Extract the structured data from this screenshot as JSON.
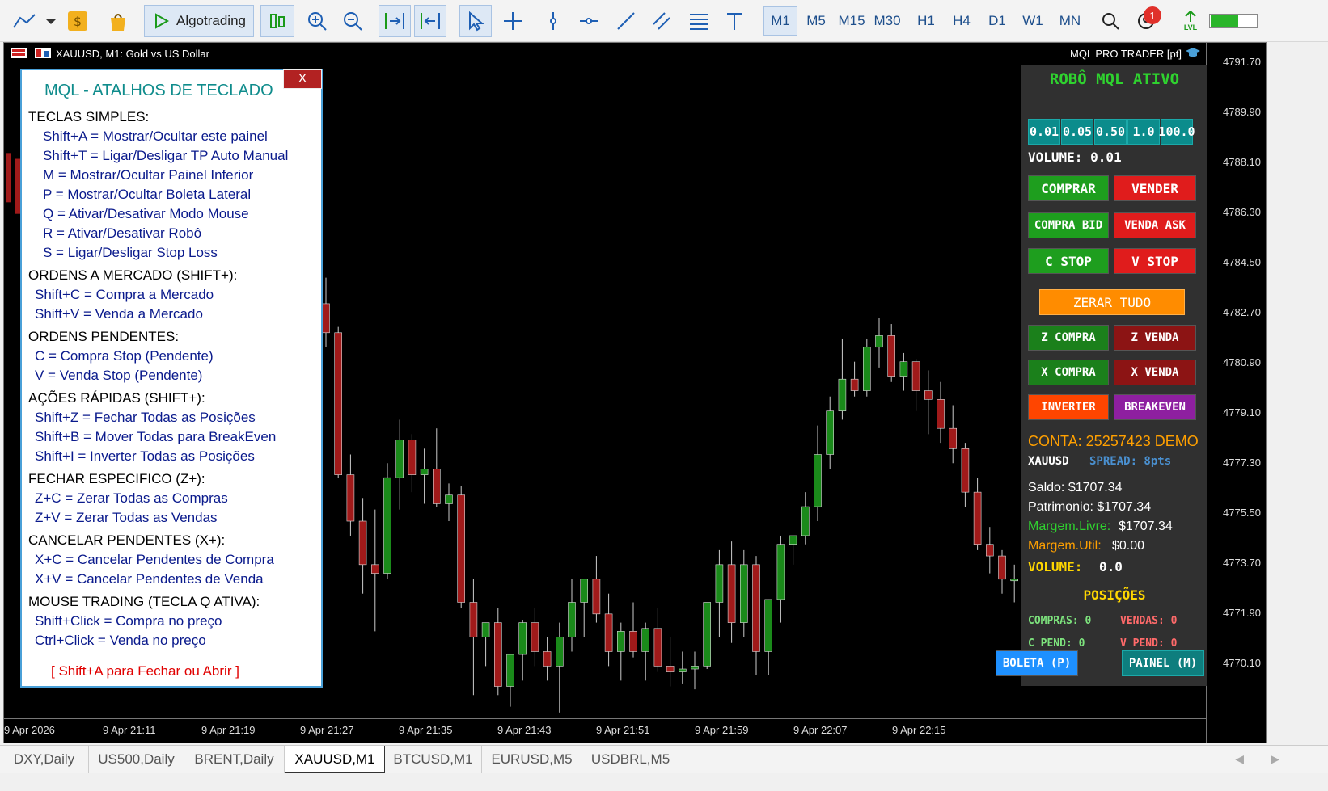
{
  "toolbar": {
    "algotrading_label": "Algotrading",
    "timeframes": [
      "M1",
      "M5",
      "M15",
      "M30",
      "H1",
      "H4",
      "D1",
      "W1",
      "MN"
    ],
    "active_timeframe": "M1",
    "notification_count": "1",
    "lvl_label": "LVL"
  },
  "chart": {
    "title": "XAUUSD, M1:  Gold vs US Dollar",
    "brand": "MQL PRO TRADER [pt]",
    "price_labels": [
      "4791.70",
      "4789.90",
      "4788.10",
      "4786.30",
      "4784.50",
      "4782.70",
      "4780.90",
      "4779.10",
      "4777.30",
      "4775.50",
      "4773.70",
      "4771.90",
      "4770.10"
    ],
    "time_labels": [
      "9 Apr 2026",
      "9 Apr 21:11",
      "9 Apr 21:19",
      "9 Apr 21:27",
      "9 Apr 21:35",
      "9 Apr 21:43",
      "9 Apr 21:51",
      "9 Apr 21:59",
      "9 Apr 22:07",
      "9 Apr 22:15"
    ],
    "colors": {
      "bull": "#1a8a1a",
      "bear": "#a01a1a"
    }
  },
  "chart_data": {
    "type": "candlestick",
    "symbol": "XAUUSD",
    "timeframe": "M1",
    "ylim": [
      4769.2,
      4792.5
    ],
    "candles": [
      {
        "o": 4783.5,
        "h": 4784.4,
        "l": 4782.0,
        "c": 4782.5
      },
      {
        "o": 4782.5,
        "h": 4782.7,
        "l": 4777.5,
        "c": 4777.6
      },
      {
        "o": 4777.6,
        "h": 4778.3,
        "l": 4775.5,
        "c": 4776.0
      },
      {
        "o": 4776.0,
        "h": 4776.8,
        "l": 4773.5,
        "c": 4774.5
      },
      {
        "o": 4774.5,
        "h": 4776.4,
        "l": 4772.2,
        "c": 4774.2
      },
      {
        "o": 4774.2,
        "h": 4778.0,
        "l": 4774.0,
        "c": 4777.5
      },
      {
        "o": 4777.5,
        "h": 4779.5,
        "l": 4776.4,
        "c": 4778.8
      },
      {
        "o": 4778.8,
        "h": 4779.0,
        "l": 4777.0,
        "c": 4777.6
      },
      {
        "o": 4777.6,
        "h": 4778.5,
        "l": 4776.6,
        "c": 4777.8
      },
      {
        "o": 4777.8,
        "h": 4779.2,
        "l": 4776.5,
        "c": 4776.6
      },
      {
        "o": 4776.6,
        "h": 4777.3,
        "l": 4776.0,
        "c": 4776.9
      },
      {
        "o": 4776.9,
        "h": 4777.2,
        "l": 4773.0,
        "c": 4773.2
      },
      {
        "o": 4773.2,
        "h": 4774.0,
        "l": 4770.0,
        "c": 4772.0
      },
      {
        "o": 4772.0,
        "h": 4772.5,
        "l": 4771.0,
        "c": 4772.5
      },
      {
        "o": 4772.5,
        "h": 4773.0,
        "l": 4770.0,
        "c": 4770.3
      },
      {
        "o": 4770.3,
        "h": 4771.2,
        "l": 4769.6,
        "c": 4771.4
      },
      {
        "o": 4771.4,
        "h": 4772.6,
        "l": 4770.5,
        "c": 4772.5
      },
      {
        "o": 4772.5,
        "h": 4773.0,
        "l": 4771.0,
        "c": 4771.5
      },
      {
        "o": 4771.5,
        "h": 4772.0,
        "l": 4770.5,
        "c": 4771.0
      },
      {
        "o": 4771.0,
        "h": 4772.5,
        "l": 4769.4,
        "c": 4772.0
      },
      {
        "o": 4772.0,
        "h": 4774.0,
        "l": 4771.5,
        "c": 4773.2
      },
      {
        "o": 4773.2,
        "h": 4773.8,
        "l": 4772.0,
        "c": 4774.0
      },
      {
        "o": 4774.0,
        "h": 4774.8,
        "l": 4772.5,
        "c": 4772.8
      },
      {
        "o": 4772.8,
        "h": 4773.5,
        "l": 4771.0,
        "c": 4771.5
      },
      {
        "o": 4771.5,
        "h": 4772.5,
        "l": 4770.5,
        "c": 4772.2
      },
      {
        "o": 4772.2,
        "h": 4773.2,
        "l": 4771.3,
        "c": 4771.5
      },
      {
        "o": 4771.5,
        "h": 4772.5,
        "l": 4770.5,
        "c": 4772.3
      },
      {
        "o": 4772.3,
        "h": 4773.0,
        "l": 4770.8,
        "c": 4771.0
      },
      {
        "o": 4771.0,
        "h": 4772.0,
        "l": 4770.3,
        "c": 4770.8
      },
      {
        "o": 4770.8,
        "h": 4771.5,
        "l": 4770.4,
        "c": 4770.9
      },
      {
        "o": 4770.9,
        "h": 4771.5,
        "l": 4770.2,
        "c": 4771.0
      },
      {
        "o": 4771.0,
        "h": 4773.0,
        "l": 4770.9,
        "c": 4773.2
      },
      {
        "o": 4773.2,
        "h": 4775.0,
        "l": 4772.0,
        "c": 4774.5
      },
      {
        "o": 4774.5,
        "h": 4775.3,
        "l": 4771.8,
        "c": 4772.5
      },
      {
        "o": 4772.5,
        "h": 4775.0,
        "l": 4772.0,
        "c": 4774.5
      },
      {
        "o": 4774.5,
        "h": 4774.8,
        "l": 4770.7,
        "c": 4771.5
      },
      {
        "o": 4771.5,
        "h": 4773.3,
        "l": 4770.7,
        "c": 4773.3
      },
      {
        "o": 4773.3,
        "h": 4775.5,
        "l": 4772.5,
        "c": 4775.2
      },
      {
        "o": 4775.2,
        "h": 4775.5,
        "l": 4774.5,
        "c": 4775.5
      },
      {
        "o": 4775.5,
        "h": 4777.0,
        "l": 4775.2,
        "c": 4776.5
      },
      {
        "o": 4776.5,
        "h": 4779.3,
        "l": 4776.0,
        "c": 4778.3
      },
      {
        "o": 4778.3,
        "h": 4780.3,
        "l": 4777.8,
        "c": 4779.8
      },
      {
        "o": 4779.8,
        "h": 4782.3,
        "l": 4779.5,
        "c": 4780.9
      },
      {
        "o": 4780.9,
        "h": 4781.5,
        "l": 4780.3,
        "c": 4780.5
      },
      {
        "o": 4780.5,
        "h": 4782.3,
        "l": 4780.3,
        "c": 4782.0
      },
      {
        "o": 4782.0,
        "h": 4783.0,
        "l": 4781.3,
        "c": 4782.4
      },
      {
        "o": 4782.4,
        "h": 4782.8,
        "l": 4780.8,
        "c": 4781.0
      },
      {
        "o": 4781.0,
        "h": 4781.8,
        "l": 4780.5,
        "c": 4781.5
      },
      {
        "o": 4781.5,
        "h": 4781.6,
        "l": 4779.8,
        "c": 4780.5
      },
      {
        "o": 4780.5,
        "h": 4781.2,
        "l": 4779.0,
        "c": 4780.2
      },
      {
        "o": 4780.2,
        "h": 4780.8,
        "l": 4778.7,
        "c": 4779.2
      },
      {
        "o": 4779.2,
        "h": 4780.0,
        "l": 4778.0,
        "c": 4778.5
      },
      {
        "o": 4778.5,
        "h": 4778.7,
        "l": 4776.5,
        "c": 4777.0
      },
      {
        "o": 4777.0,
        "h": 4777.5,
        "l": 4775.0,
        "c": 4775.2
      },
      {
        "o": 4775.2,
        "h": 4775.8,
        "l": 4774.2,
        "c": 4774.8
      },
      {
        "o": 4774.8,
        "h": 4775.0,
        "l": 4773.5,
        "c": 4774.0
      },
      {
        "o": 4774.0,
        "h": 4774.5,
        "l": 4773.2,
        "c": 4774.0
      },
      {
        "o": 4774.0,
        "h": 4774.6,
        "l": 4772.9,
        "c": 4773.8
      }
    ]
  },
  "shortcuts_panel": {
    "close_label": "X",
    "title": "MQL - ATALHOS DE TECLADO",
    "lines": [
      {
        "t": "h",
        "text": "TECLAS SIMPLES:"
      },
      {
        "t": "k2",
        "text": "Shift+A = Mostrar/Ocultar este painel"
      },
      {
        "t": "k2",
        "text": "Shift+T = Ligar/Desligar TP Auto Manual"
      },
      {
        "t": "k2",
        "text": "M = Mostrar/Ocultar Painel Inferior"
      },
      {
        "t": "k2",
        "text": "P = Mostrar/Ocultar Boleta Lateral"
      },
      {
        "t": "k2",
        "text": "Q = Ativar/Desativar Modo Mouse"
      },
      {
        "t": "k2",
        "text": "R = Ativar/Desativar Robô"
      },
      {
        "t": "k2",
        "text": "S = Ligar/Desligar Stop Loss"
      },
      {
        "t": "h",
        "text": "ORDENS A MERCADO (SHIFT+):"
      },
      {
        "t": "k1",
        "text": "Shift+C = Compra a Mercado"
      },
      {
        "t": "k1",
        "text": "Shift+V = Venda a Mercado"
      },
      {
        "t": "h",
        "text": "ORDENS PENDENTES:"
      },
      {
        "t": "k1",
        "text": "C = Compra Stop (Pendente)"
      },
      {
        "t": "k1",
        "text": "V = Venda Stop (Pendente)"
      },
      {
        "t": "h",
        "text": "AÇÕES RÁPIDAS (SHIFT+):"
      },
      {
        "t": "k1",
        "text": "Shift+Z = Fechar Todas as Posições"
      },
      {
        "t": "k1",
        "text": "Shift+B = Mover Todas para BreakEven"
      },
      {
        "t": "k1",
        "text": "Shift+I = Inverter Todas as Posições"
      },
      {
        "t": "h",
        "text": "FECHAR ESPECIFICO (Z+):"
      },
      {
        "t": "k1",
        "text": "Z+C = Zerar Todas as Compras"
      },
      {
        "t": "k1",
        "text": "Z+V = Zerar Todas as Vendas"
      },
      {
        "t": "h",
        "text": "CANCELAR PENDENTES (X+):"
      },
      {
        "t": "k1",
        "text": "X+C = Cancelar Pendentes de Compra"
      },
      {
        "t": "k1",
        "text": "X+V = Cancelar Pendentes de Venda"
      },
      {
        "t": "h",
        "text": "MOUSE TRADING (TECLA Q ATIVA):"
      },
      {
        "t": "k1",
        "text": "Shift+Click = Compra no preço"
      },
      {
        "t": "k1",
        "text": "Ctrl+Click  = Venda no preço"
      },
      {
        "t": "f",
        "text": "[ Shift+A para Fechar ou Abrir ]"
      }
    ]
  },
  "robot_panel": {
    "status": "ROBÔ MQL ATIVO",
    "lots": [
      "0.01",
      "0.05",
      "0.50",
      "1.0",
      "100.0"
    ],
    "volume": "VOLUME: 0.01",
    "buttons": {
      "comprar": "COMPRAR",
      "vender": "VENDER",
      "compra_bid": "COMPRA BID",
      "venda_ask": "VENDA ASK",
      "c_stop": "C STOP",
      "v_stop": "V STOP",
      "zerar_tudo": "ZERAR TUDO",
      "z_compra": "Z COMPRA",
      "z_venda": "Z VENDA",
      "x_compra": "X COMPRA",
      "x_venda": "X VENDA",
      "inverter": "INVERTER",
      "breakeven": "BREAKEVEN",
      "boleta": "BOLETA (P)",
      "painel": "PAINEL (M)"
    },
    "account": "CONTA: 25257423 DEMO",
    "symbol": "XAUUSD",
    "spread": "SPREAD: 8pts",
    "saldo": "Saldo: $1707.34",
    "patrimonio": "Patrimonio: $1707.34",
    "margem_livre_label": "Margem.Livre:",
    "margem_livre_value": "$1707.34",
    "margem_util_label": "Margem.Util:",
    "margem_util_value": "$0.00",
    "volume_label": "VOLUME:",
    "volume_value": "0.0",
    "posicoes": "POSIÇÕES",
    "compras": "COMPRAS: 0",
    "vendas": "VENDAS: 0",
    "c_pend": "C PEND: 0",
    "v_pend": "V PEND: 0"
  },
  "tabs": {
    "items": [
      "DXY,Daily",
      "US500,Daily",
      "BRENT,Daily",
      "XAUUSD,M1",
      "BTCUSD,M1",
      "EURUSD,M5",
      "USDBRL,M5"
    ],
    "active": "XAUUSD,M1"
  }
}
